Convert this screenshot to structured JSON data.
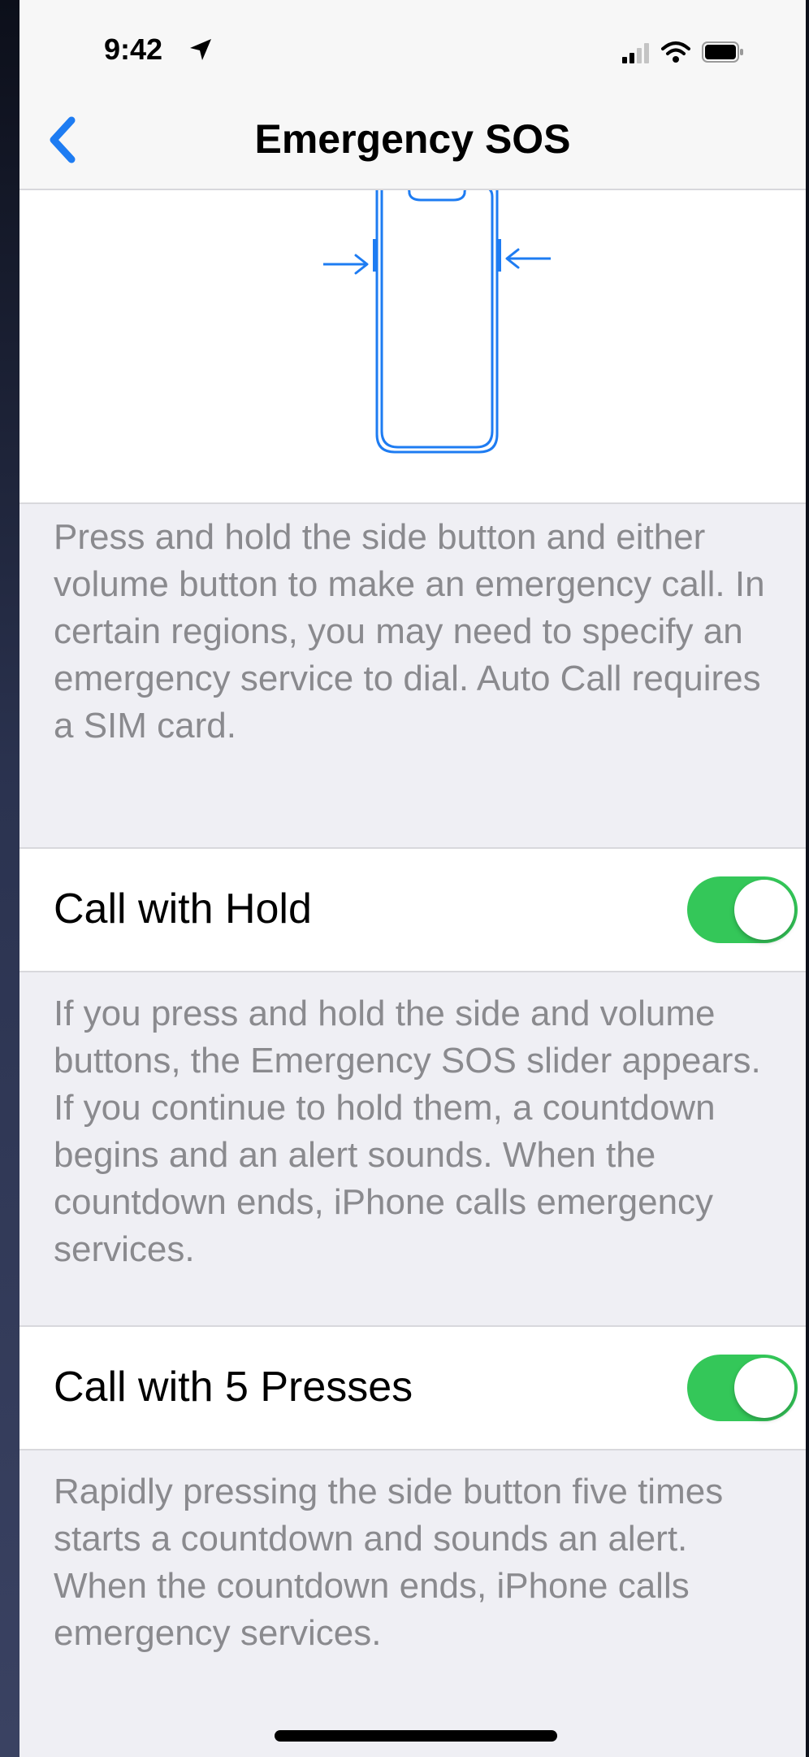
{
  "status_bar": {
    "time": "9:42"
  },
  "nav": {
    "title": "Emergency SOS",
    "back_icon": "chevron-left-icon"
  },
  "illustration": {
    "icon": "iphone-side-buttons-icon"
  },
  "description": "Press and hold the side button and either volume button to make an emergency call. In certain regions, you may need to specify an emergency service to dial. Auto Call requires a SIM card.",
  "settings": [
    {
      "label": "Call with Hold",
      "enabled": true,
      "footer": "If you press and hold the side and volume buttons, the Emergency SOS slider appears. If you continue to hold them, a countdown begins and an alert sounds. When the countdown ends, iPhone calls emergency services."
    },
    {
      "label": "Call with 5 Presses",
      "enabled": true,
      "footer": "Rapidly pressing the side button five times starts a countdown and sounds an alert. When the countdown ends, iPhone calls emergency services."
    }
  ],
  "colors": {
    "accent": "#1e7cf2",
    "toggle_on": "#34c759",
    "background": "#efeff4",
    "footer_text": "#8a8a8e"
  }
}
